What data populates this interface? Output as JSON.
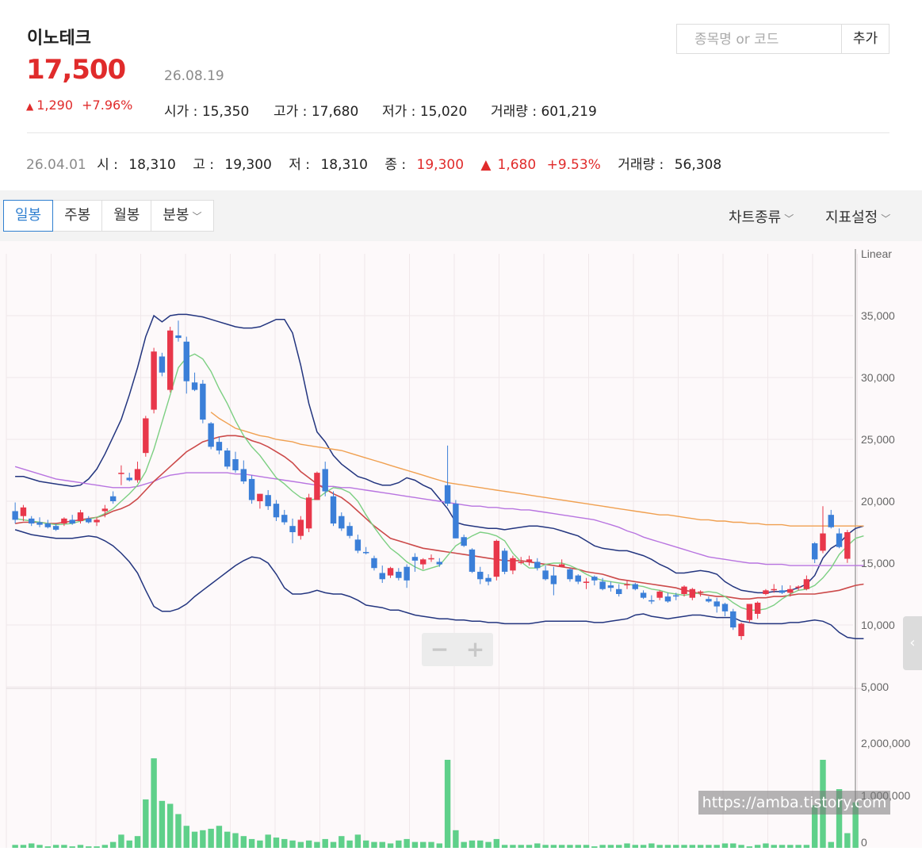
{
  "header": {
    "stock_name": "이노테크",
    "price": "17,500",
    "date": "26.08.19",
    "change_arrow": "▲",
    "change_amount": "1,290",
    "change_pct": "+7.96%",
    "open_label": "시가 : ",
    "open": "15,350",
    "high_label": "고가 : ",
    "high": "17,680",
    "low_label": "저가 : ",
    "low": "15,020",
    "volume_label": "거래량 : ",
    "volume": "601,219"
  },
  "history_row": {
    "date": "26.04.01",
    "open_label": "시 : ",
    "open": "18,310",
    "high_label": "고 : ",
    "high": "19,300",
    "low_label": "저 : ",
    "low": "18,310",
    "close_label": "종 : ",
    "close": "19,300",
    "arrow": "▲",
    "change": "1,680",
    "change_pct": "+9.53%",
    "volume_label": "거래량 : ",
    "volume": "56,308"
  },
  "search": {
    "placeholder": "종목명 or 코드",
    "add_label": "추가"
  },
  "toolbar": {
    "periods": [
      "일봉",
      "주봉",
      "월봉",
      "분봉"
    ],
    "chart_type_label": "차트종류",
    "indicator_label": "지표설정"
  },
  "zoom": {
    "minus": "−",
    "plus": "+"
  },
  "watermark": "https://amba.tistory.com",
  "colors": {
    "up": "#e8374a",
    "down": "#3b7fd8",
    "volume": "#5fd08a",
    "price_red": "#e02b2b"
  },
  "chart_data": {
    "type": "candlestick",
    "scale_label": "Linear",
    "price_axis": {
      "ylim": [
        5000,
        40000
      ],
      "ticks": [
        "35,000",
        "30,000",
        "25,000",
        "20,000",
        "15,000",
        "10,000",
        "5,000"
      ]
    },
    "volume_axis": {
      "ylim": [
        0,
        2800000
      ],
      "ticks": [
        "2,000,000",
        "1,000,000",
        "0"
      ]
    },
    "candles": [
      [
        19200,
        19900,
        18200,
        18500
      ],
      [
        18800,
        19700,
        18400,
        19500
      ],
      [
        18600,
        18800,
        18000,
        18200
      ],
      [
        18300,
        18700,
        17900,
        18100
      ],
      [
        18200,
        18500,
        17800,
        17900
      ],
      [
        18000,
        18200,
        17600,
        17700
      ],
      [
        18200,
        18700,
        18000,
        18600
      ],
      [
        18500,
        18900,
        18100,
        18200
      ],
      [
        18400,
        19300,
        18200,
        19100
      ],
      [
        18600,
        18800,
        18200,
        18300
      ],
      [
        18300,
        18700,
        18000,
        18500
      ],
      [
        19200,
        19700,
        18700,
        19400
      ],
      [
        20400,
        20800,
        19800,
        20000
      ],
      [
        22200,
        22900,
        21300,
        22300
      ],
      [
        21900,
        22300,
        21600,
        21700
      ],
      [
        21700,
        23200,
        21500,
        22600
      ],
      [
        23900,
        26900,
        23600,
        26700
      ],
      [
        27400,
        32400,
        27100,
        32100
      ],
      [
        31700,
        32000,
        30100,
        30400
      ],
      [
        29000,
        34100,
        28800,
        33800
      ],
      [
        33400,
        34600,
        32900,
        33200
      ],
      [
        32900,
        33300,
        28700,
        29700
      ],
      [
        29600,
        30400,
        28900,
        29000
      ],
      [
        29500,
        29800,
        26300,
        26600
      ],
      [
        26300,
        26400,
        24200,
        24400
      ],
      [
        24800,
        25200,
        23800,
        24100
      ],
      [
        24100,
        24300,
        22600,
        22800
      ],
      [
        23400,
        24000,
        22300,
        22500
      ],
      [
        22600,
        23300,
        21400,
        21600
      ],
      [
        21800,
        22100,
        19800,
        20100
      ],
      [
        20000,
        20600,
        19400,
        20600
      ],
      [
        20500,
        20900,
        19300,
        19600
      ],
      [
        19800,
        20100,
        18400,
        18700
      ],
      [
        18900,
        19300,
        18100,
        18300
      ],
      [
        18000,
        18600,
        16600,
        17500
      ],
      [
        17200,
        18800,
        16900,
        18500
      ],
      [
        17800,
        20600,
        17500,
        20300
      ],
      [
        20100,
        22400,
        20100,
        22300
      ],
      [
        22600,
        23200,
        20400,
        20800
      ],
      [
        20400,
        20800,
        18000,
        18200
      ],
      [
        18800,
        19100,
        17600,
        17800
      ],
      [
        18000,
        18300,
        17000,
        17200
      ],
      [
        16900,
        17300,
        15800,
        16000
      ],
      [
        15900,
        16300,
        15700,
        15800
      ],
      [
        15400,
        15600,
        14400,
        14600
      ],
      [
        14200,
        14800,
        13400,
        13700
      ],
      [
        14000,
        14700,
        13800,
        14600
      ],
      [
        14300,
        14600,
        13600,
        13800
      ],
      [
        14700,
        14900,
        13000,
        13600
      ],
      [
        15500,
        15800,
        14300,
        15200
      ],
      [
        14900,
        15400,
        14500,
        15300
      ],
      [
        15300,
        15700,
        15100,
        15400
      ],
      [
        15100,
        15400,
        14700,
        14900
      ],
      [
        21300,
        24500,
        19600,
        19800
      ],
      [
        19800,
        20100,
        17000,
        17000
      ],
      [
        17100,
        17300,
        16300,
        16400
      ],
      [
        16100,
        16200,
        14200,
        14300
      ],
      [
        14300,
        14700,
        13300,
        13700
      ],
      [
        13800,
        14100,
        13200,
        13500
      ],
      [
        13900,
        16900,
        13600,
        16800
      ],
      [
        16000,
        16200,
        14100,
        14300
      ],
      [
        14400,
        15600,
        14100,
        15400
      ],
      [
        15100,
        15500,
        14900,
        15100
      ],
      [
        15100,
        15600,
        14800,
        15300
      ],
      [
        15100,
        15400,
        14400,
        14600
      ],
      [
        14400,
        14800,
        13600,
        13700
      ],
      [
        14000,
        14700,
        12400,
        13300
      ],
      [
        14700,
        15300,
        14700,
        14900
      ],
      [
        14500,
        14600,
        13500,
        13700
      ],
      [
        14000,
        14100,
        13300,
        13500
      ],
      [
        13400,
        13800,
        12900,
        13500
      ],
      [
        13900,
        14000,
        13200,
        13600
      ],
      [
        13500,
        13800,
        12800,
        12900
      ],
      [
        13200,
        13500,
        12700,
        13000
      ],
      [
        12900,
        13300,
        12300,
        12500
      ],
      [
        13200,
        13600,
        12900,
        13300
      ],
      [
        13300,
        13400,
        12800,
        12900
      ],
      [
        12600,
        12800,
        12100,
        12200
      ],
      [
        12000,
        12400,
        11700,
        11900
      ],
      [
        12200,
        12800,
        12000,
        12700
      ],
      [
        12300,
        12600,
        11800,
        11900
      ],
      [
        12400,
        12600,
        12000,
        12300
      ],
      [
        12500,
        13200,
        12300,
        13100
      ],
      [
        12200,
        13000,
        12000,
        12900
      ],
      [
        12600,
        12800,
        12300,
        12700
      ],
      [
        12100,
        12300,
        11800,
        11900
      ],
      [
        11900,
        12200,
        11000,
        11500
      ],
      [
        11700,
        11800,
        10700,
        11100
      ],
      [
        11100,
        11300,
        9600,
        9800
      ],
      [
        9100,
        10200,
        8800,
        10100
      ],
      [
        10400,
        11700,
        10200,
        11700
      ],
      [
        10900,
        11900,
        10500,
        11800
      ],
      [
        12500,
        12900,
        12400,
        12800
      ],
      [
        12900,
        13300,
        12600,
        12900
      ],
      [
        12800,
        13200,
        12500,
        12600
      ],
      [
        12600,
        13200,
        12300,
        12900
      ],
      [
        13000,
        13200,
        12800,
        13100
      ],
      [
        12900,
        14000,
        12800,
        13700
      ],
      [
        16600,
        16700,
        15000,
        15300
      ],
      [
        16000,
        19600,
        15800,
        17400
      ],
      [
        18900,
        19300,
        17800,
        17900
      ],
      [
        17400,
        17800,
        16200,
        16300
      ],
      [
        15350,
        17680,
        15020,
        17500
      ]
    ],
    "volume": [
      20,
      20,
      30,
      20,
      10,
      20,
      20,
      10,
      20,
      10,
      10,
      20,
      40,
      90,
      50,
      80,
      330,
      610,
      320,
      300,
      230,
      150,
      110,
      120,
      130,
      150,
      110,
      100,
      80,
      60,
      50,
      90,
      70,
      60,
      50,
      40,
      50,
      40,
      60,
      40,
      80,
      50,
      90,
      50,
      40,
      40,
      30,
      50,
      60,
      40,
      40,
      40,
      30,
      600,
      120,
      40,
      50,
      50,
      40,
      60,
      20,
      20,
      20,
      20,
      30,
      20,
      20,
      20,
      20,
      20,
      20,
      10,
      20,
      20,
      20,
      30,
      20,
      20,
      30,
      20,
      20,
      20,
      20,
      20,
      20,
      20,
      20,
      30,
      30,
      20,
      10,
      20,
      30,
      20,
      20,
      20,
      20,
      20,
      290,
      600,
      40,
      400,
      100,
      310
    ],
    "volume_scale_max": 2800000,
    "ma5": [
      18600,
      18500,
      18400,
      18300,
      18200,
      18100,
      18150,
      18200,
      18400,
      18550,
      18700,
      19000,
      19400,
      20000,
      20600,
      21300,
      22400,
      24200,
      26400,
      28600,
      30800,
      31600,
      31900,
      31500,
      30500,
      29100,
      27900,
      26500,
      25300,
      24400,
      23700,
      22800,
      21900,
      21400,
      20800,
      20300,
      20100,
      20200,
      20700,
      21100,
      21000,
      20700,
      20000,
      18900,
      17900,
      17000,
      16200,
      15700,
      15100,
      14700,
      14400,
      14600,
      14800,
      15600,
      16400,
      16800,
      17200,
      17500,
      17400,
      17200,
      16800,
      15800,
      15100,
      14600,
      14600,
      14900,
      15000,
      15000,
      14800,
      14500,
      14100,
      13800,
      13600,
      13500,
      13400,
      13300,
      13200,
      13100,
      12900,
      12800,
      12600,
      12500,
      12400,
      12500,
      12600,
      12700,
      12600,
      12300,
      11800,
      11400,
      11200,
      11200,
      11300,
      11600,
      12100,
      12500,
      12800,
      12900,
      13200,
      13800,
      14600,
      15700,
      16400,
      17000,
      17200
    ],
    "ma20": [
      18200,
      18300,
      18300,
      18300,
      18200,
      18200,
      18300,
      18400,
      18500,
      18600,
      18700,
      18900,
      19200,
      19400,
      19700,
      20200,
      20900,
      21600,
      22200,
      22800,
      23400,
      24000,
      24400,
      24800,
      25000,
      25200,
      25300,
      25300,
      25200,
      24900,
      24700,
      24400,
      24000,
      23600,
      23100,
      22400,
      21900,
      21400,
      21000,
      20600,
      20300,
      19800,
      19200,
      18600,
      18000,
      17500,
      17000,
      16800,
      16600,
      16400,
      16200,
      16100,
      16000,
      15900,
      15800,
      15700,
      15600,
      15500,
      15400,
      15300,
      15200,
      15200,
      15200,
      15100,
      15000,
      14900,
      14800,
      14700,
      14600,
      14500,
      14300,
      14200,
      14100,
      13900,
      13700,
      13600,
      13500,
      13400,
      13300,
      13200,
      13100,
      13000,
      12800,
      12700,
      12500,
      12400,
      12300,
      12300,
      12200,
      12100,
      12100,
      12200,
      12200,
      12300,
      12300,
      12400,
      12500,
      12500,
      12500,
      12600,
      12700,
      12800,
      13000,
      13200,
      13300
    ],
    "ma60": [
      null,
      null,
      null,
      null,
      null,
      null,
      null,
      null,
      null,
      null,
      null,
      null,
      null,
      null,
      null,
      null,
      null,
      null,
      null,
      null,
      null,
      null,
      null,
      null,
      27200,
      26700,
      26300,
      25900,
      25700,
      25500,
      25300,
      25200,
      25000,
      24900,
      24800,
      24600,
      24500,
      24400,
      24300,
      24200,
      24100,
      23900,
      23700,
      23500,
      23300,
      23100,
      22900,
      22700,
      22500,
      22300,
      22100,
      21900,
      21700,
      21500,
      21400,
      21300,
      21200,
      21100,
      21000,
      20900,
      20800,
      20700,
      20600,
      20500,
      20400,
      20300,
      20200,
      20100,
      20000,
      19900,
      19800,
      19700,
      19600,
      19500,
      19400,
      19300,
      19200,
      19100,
      19000,
      18900,
      18900,
      18800,
      18700,
      18600,
      18500,
      18500,
      18400,
      18400,
      18300,
      18300,
      18200,
      18200,
      18100,
      18100,
      18100,
      18000,
      18000,
      18000,
      18000,
      18000,
      18000,
      18000,
      18000,
      18000,
      18000
    ],
    "ma120": [
      22800,
      22600,
      22400,
      22200,
      22000,
      21800,
      21700,
      21600,
      21500,
      21400,
      21300,
      21200,
      21100,
      21100,
      21100,
      21200,
      21400,
      21600,
      21900,
      22100,
      22200,
      22300,
      22300,
      22300,
      22300,
      22300,
      22300,
      22200,
      22200,
      22100,
      22000,
      21900,
      21800,
      21700,
      21600,
      21500,
      21400,
      21300,
      21200,
      21200,
      21100,
      21100,
      21000,
      20900,
      20800,
      20700,
      20600,
      20500,
      20400,
      20300,
      20200,
      20100,
      20000,
      19900,
      19800,
      19700,
      19600,
      19600,
      19500,
      19500,
      19400,
      19400,
      19300,
      19300,
      19200,
      19100,
      19000,
      18900,
      18800,
      18700,
      18600,
      18500,
      18300,
      18100,
      17900,
      17600,
      17400,
      17100,
      16900,
      16700,
      16500,
      16300,
      16100,
      15900,
      15700,
      15500,
      15400,
      15300,
      15200,
      15100,
      15000,
      15000,
      14900,
      14900,
      14900,
      14800,
      14800,
      14800,
      14800,
      14800,
      14800,
      14800,
      14800,
      14800,
      14800
    ],
    "bb_upper": [
      22000,
      22000,
      21800,
      21600,
      21500,
      21400,
      21300,
      21200,
      21300,
      21800,
      22600,
      23800,
      25200,
      26600,
      28600,
      30800,
      33300,
      35000,
      34500,
      35000,
      35100,
      35100,
      35000,
      34900,
      34700,
      34500,
      34300,
      34100,
      34000,
      34000,
      34100,
      34400,
      34700,
      34700,
      33600,
      31000,
      27900,
      25600,
      24800,
      23700,
      23000,
      22500,
      22000,
      21800,
      21500,
      21300,
      21300,
      21500,
      21900,
      21700,
      21300,
      21000,
      20200,
      19400,
      18300,
      18100,
      18000,
      17900,
      17800,
      17800,
      17700,
      17800,
      17900,
      18000,
      18000,
      17900,
      17800,
      17600,
      17400,
      17200,
      16800,
      16400,
      16200,
      16100,
      16000,
      16000,
      15800,
      15600,
      15300,
      14900,
      14600,
      14200,
      14200,
      14300,
      14400,
      14300,
      14100,
      13500,
      13100,
      12800,
      12700,
      12600,
      12600,
      12700,
      12700,
      12800,
      13000,
      13300,
      14000,
      15400,
      16200,
      16600,
      17300,
      17800,
      18000
    ],
    "bb_lower": [
      17700,
      17500,
      17300,
      17200,
      17100,
      17000,
      17000,
      17000,
      17100,
      17200,
      17100,
      16800,
      16400,
      15800,
      15100,
      14200,
      12800,
      11500,
      11100,
      11100,
      11300,
      11700,
      12300,
      12800,
      13300,
      13800,
      14300,
      14800,
      15200,
      15500,
      15400,
      15000,
      14100,
      13000,
      12500,
      12500,
      12600,
      12800,
      12600,
      12500,
      12500,
      12300,
      12000,
      11600,
      11500,
      11400,
      11200,
      11200,
      11000,
      10800,
      10700,
      10600,
      10500,
      10500,
      10400,
      10400,
      10300,
      10300,
      10200,
      10200,
      10100,
      10100,
      10100,
      10100,
      10200,
      10300,
      10300,
      10300,
      10300,
      10300,
      10300,
      10200,
      10200,
      10300,
      10400,
      10500,
      10800,
      10900,
      10700,
      10600,
      10500,
      10600,
      10700,
      10800,
      10800,
      10700,
      10600,
      10600,
      10600,
      10300,
      10200,
      10100,
      10100,
      10100,
      10100,
      10200,
      10200,
      10300,
      10400,
      10300,
      10000,
      9400,
      9000,
      8900,
      8900
    ]
  }
}
